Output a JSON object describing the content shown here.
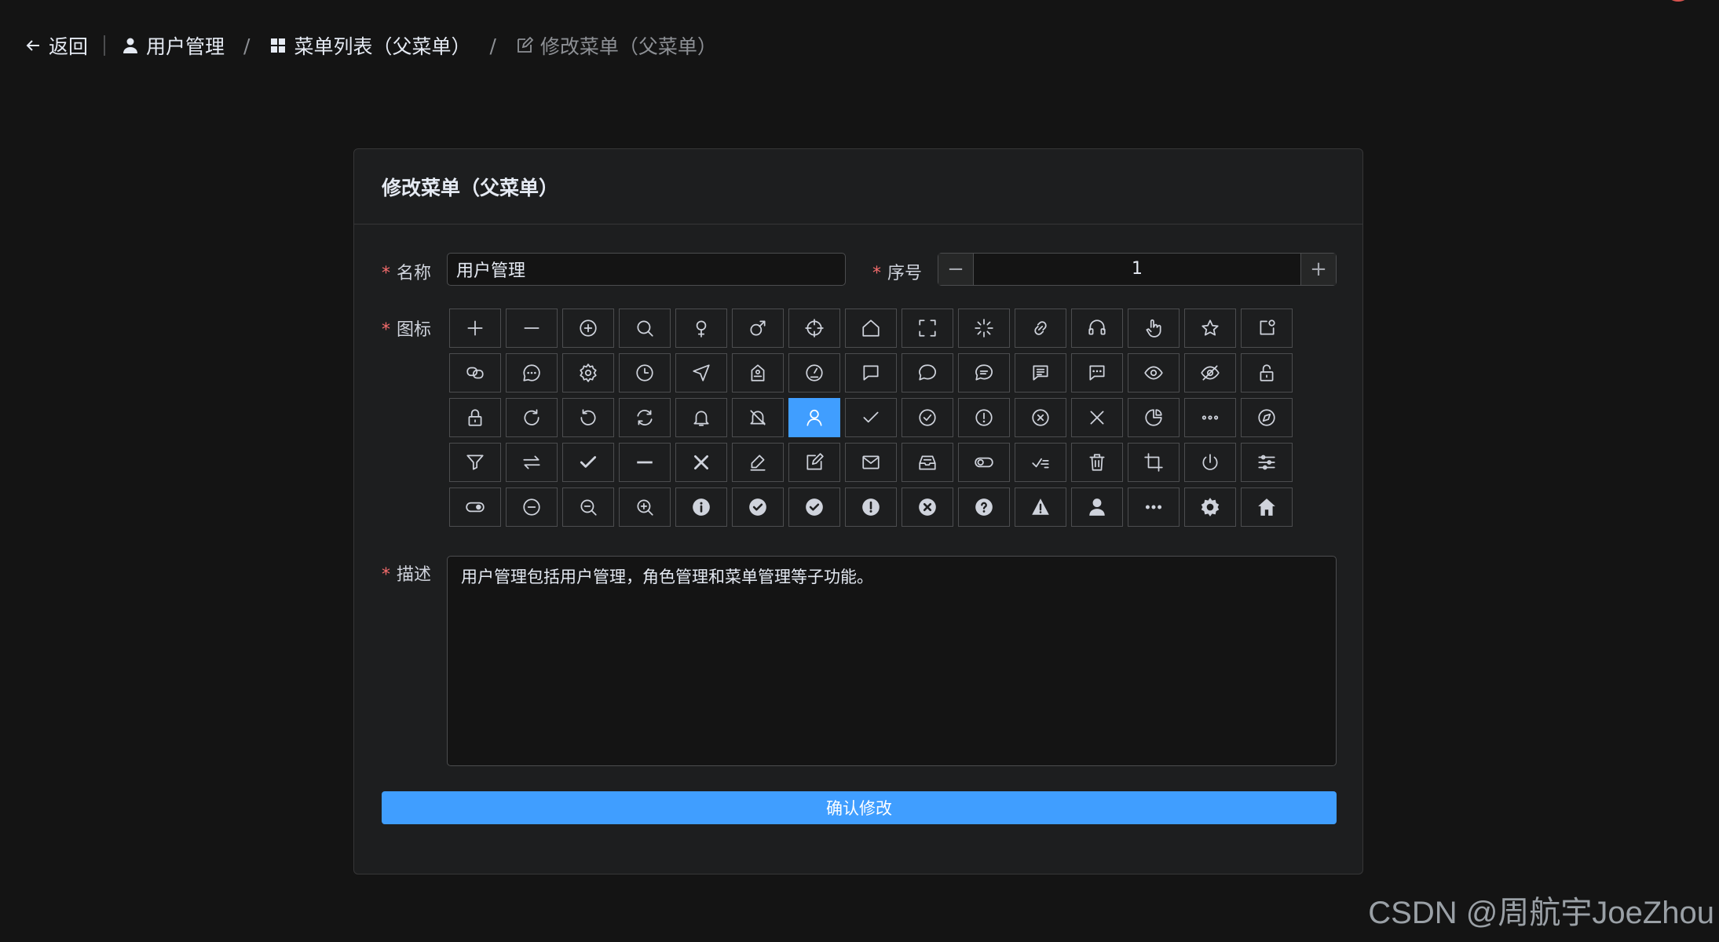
{
  "breadcrumb": {
    "back": "返回",
    "items": [
      "用户管理",
      "菜单列表（父菜单）",
      "修改菜单（父菜单）"
    ]
  },
  "form": {
    "title": "修改菜单（父菜单）",
    "name_label": "名称",
    "name_value": "用户管理",
    "order_label": "序号",
    "order_value": "1",
    "icon_label": "图标",
    "selected_icon": "user-icon",
    "desc_label": "描述",
    "desc_value": "用户管理包括用户管理，角色管理和菜单管理等子功能。",
    "submit": "确认修改",
    "required_mark": "*"
  },
  "icons": [
    "plus-icon",
    "minus-icon",
    "circle-plus-icon",
    "search-icon",
    "female-icon",
    "male-icon",
    "aim-icon",
    "house-icon",
    "full-screen-icon",
    "loading-icon",
    "link-icon",
    "service-icon",
    "pointer-icon",
    "star-icon",
    "notification-icon",
    "connection-icon",
    "chat-dot-round-icon",
    "setting-icon",
    "clock-icon",
    "position-icon",
    "discount-icon",
    "odometer-icon",
    "chat-square-icon",
    "chat-round-icon",
    "chat-line-round-icon",
    "chat-line-square-icon",
    "chat-dot-square-icon",
    "view-icon",
    "hide-icon",
    "unlock-icon",
    "lock-icon",
    "refresh-right-icon",
    "refresh-left-icon",
    "refresh-icon",
    "bell-icon",
    "mute-notification-icon",
    "user-icon",
    "check-icon",
    "circle-check-icon",
    "warning-icon",
    "circle-close-icon",
    "close-icon",
    "pie-chart-icon",
    "more-icon",
    "compass-icon",
    "filter-icon",
    "switch-icon",
    "select-icon",
    "semi-select-icon",
    "close-bold-icon",
    "edit-pen-icon",
    "edit-icon",
    "message-icon",
    "message-box-icon",
    "turn-off-icon",
    "finished-icon",
    "delete-icon",
    "crop-icon",
    "switch-button-icon",
    "operation-icon",
    "open-icon",
    "remove-icon",
    "zoom-out-icon",
    "zoom-in-icon",
    "info-filled-icon",
    "circle-check-filled-icon",
    "success-filled-icon",
    "warning-filled-icon",
    "circle-close-filled-icon",
    "question-filled-icon",
    "warn-triangle-filled-icon",
    "user-filled-icon",
    "more-filled-icon",
    "tools-icon",
    "home-filled-icon"
  ],
  "watermark": "CSDN @周航宇JoeZhou",
  "colors": {
    "accent": "#409eff",
    "required": "#f56c6c",
    "background": "#141414",
    "card": "#1d1e1f"
  }
}
